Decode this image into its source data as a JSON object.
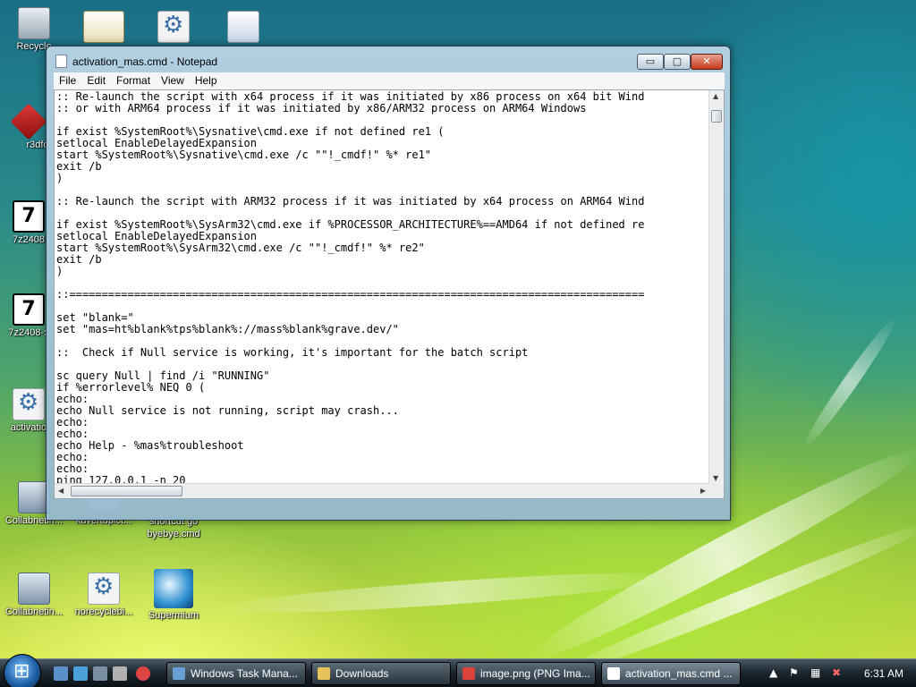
{
  "desktop": {
    "icons": [
      {
        "label": "Recycle",
        "icon": "recycle-bin-icon"
      },
      {
        "label": "",
        "icon": "certificate-icon"
      },
      {
        "label": "",
        "icon": "settings-file-icon"
      },
      {
        "label": "",
        "icon": "document-icon"
      },
      {
        "label": "r3dfo",
        "icon": "red-shortcut-icon"
      },
      {
        "label": "7z2408",
        "icon": "7zip-icon"
      },
      {
        "label": "7z2408-x",
        "icon": "7zip-icon"
      },
      {
        "label": "activatio",
        "icon": "settings-file-icon"
      },
      {
        "label": "Collabnetin...",
        "icon": "network-computer-icon"
      },
      {
        "label": "kuvertupict...",
        "icon": "document-icon"
      },
      {
        "label": "shortcut go byebye.cmd",
        "icon": "cmd-file-icon"
      },
      {
        "label": "Collabnetin...",
        "icon": "network-computer-icon"
      },
      {
        "label": "norecyclebi...",
        "icon": "settings-file-icon"
      },
      {
        "label": "Supermium",
        "icon": "supermium-browser-icon"
      }
    ]
  },
  "window": {
    "title": "activation_mas.cmd - Notepad",
    "controls": {
      "minimize": "▭",
      "maximize": "▢",
      "close": "✕"
    },
    "menu": [
      "File",
      "Edit",
      "Format",
      "View",
      "Help"
    ],
    "content": ":: Re-launch the script with x64 process if it was initiated by x86 process on x64 bit Wind\n:: or with ARM64 process if it was initiated by x86/ARM32 process on ARM64 Windows\n\nif exist %SystemRoot%\\Sysnative\\cmd.exe if not defined re1 (\nsetlocal EnableDelayedExpansion\nstart %SystemRoot%\\Sysnative\\cmd.exe /c \"\"!_cmdf!\" %* re1\"\nexit /b\n)\n\n:: Re-launch the script with ARM32 process if it was initiated by x64 process on ARM64 Wind\n\nif exist %SystemRoot%\\SysArm32\\cmd.exe if %PROCESSOR_ARCHITECTURE%==AMD64 if not defined re\nsetlocal EnableDelayedExpansion\nstart %SystemRoot%\\SysArm32\\cmd.exe /c \"\"!_cmdf!\" %* re2\"\nexit /b\n)\n\n::=========================================================================================\n\nset \"blank=\"\nset \"mas=ht%blank%tps%blank%://mass%blank%grave.dev/\"\n\n::  Check if Null service is working, it's important for the batch script\n\nsc query Null | find /i \"RUNNING\"\nif %errorlevel% NEQ 0 (\necho:\necho Null service is not running, script may crash...\necho:\necho:\necho Help - %mas%troubleshoot\necho:\necho:\nping 127.0.0.1 -n 20"
  },
  "taskbar": {
    "items": [
      {
        "label": "Windows Task Mana...",
        "icon": "task-manager-icon",
        "color": "#6aa0d8"
      },
      {
        "label": "Downloads",
        "icon": "folder-icon",
        "color": "#e8c25a"
      },
      {
        "label": "image.png (PNG Ima...",
        "icon": "browser-icon",
        "color": "#d8433a"
      },
      {
        "label": "activation_mas.cmd ...",
        "icon": "notepad-icon",
        "color": "#ffffff"
      }
    ],
    "clock": "6:31 AM"
  }
}
